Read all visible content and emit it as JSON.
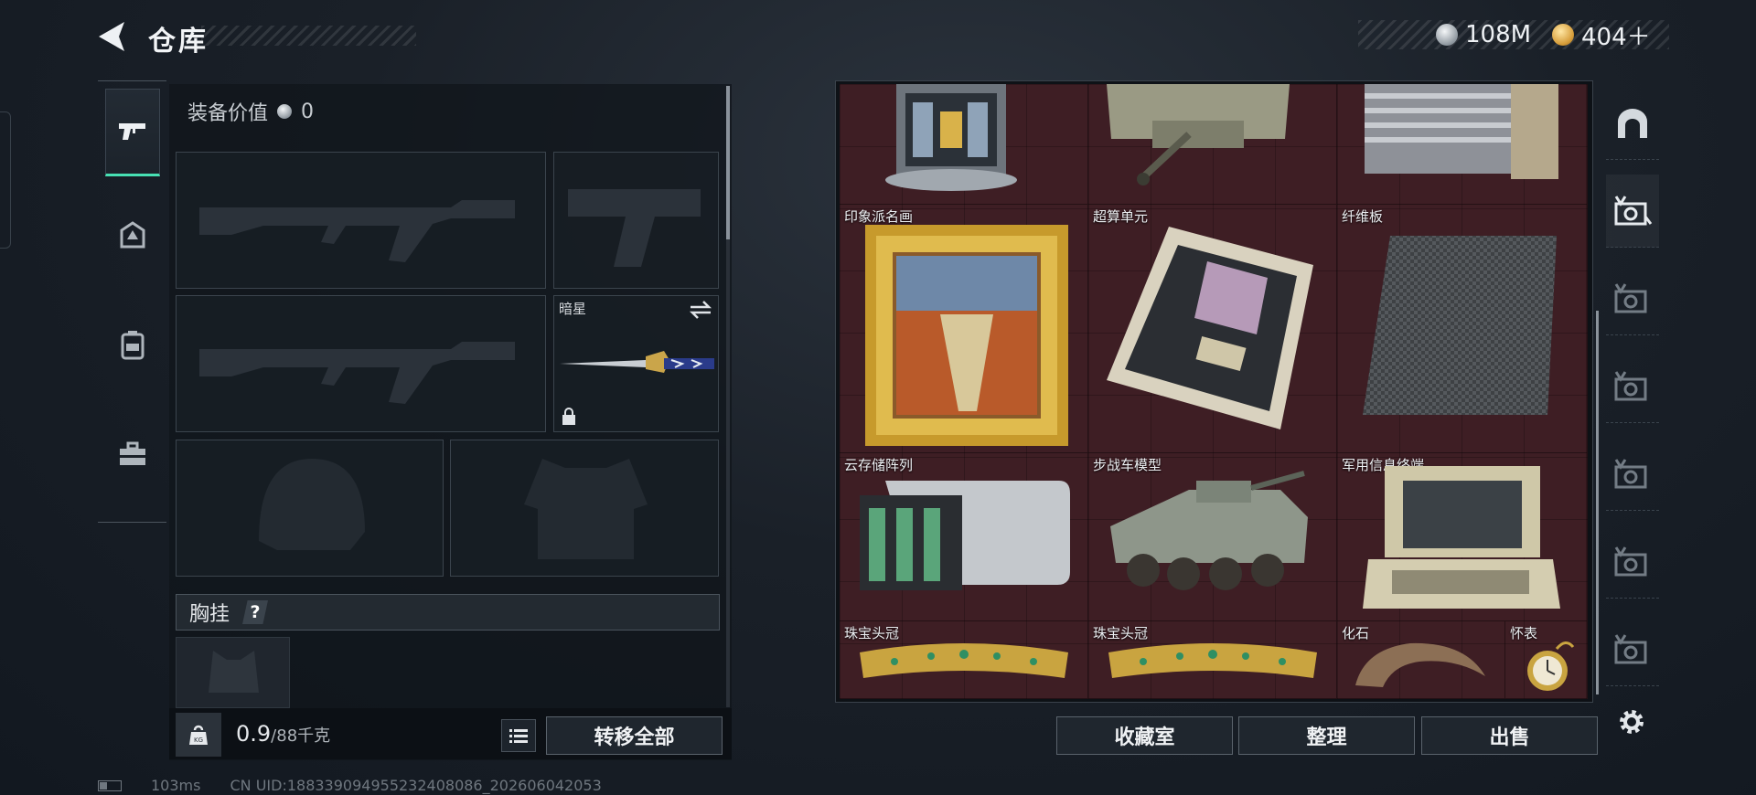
{
  "header": {
    "title": "仓库",
    "back_icon": "back-arrow-icon"
  },
  "currencies": [
    {
      "icon": "silver-coin-icon",
      "color": "#b9c0c7",
      "value": "108M"
    },
    {
      "icon": "gold-coin-icon",
      "color": "#d69d3a",
      "value": "404＋"
    }
  ],
  "left_tabs": [
    {
      "icon": "pistol-icon",
      "active": true
    },
    {
      "icon": "helmet-icon",
      "active": false
    },
    {
      "icon": "backpack-icon",
      "active": false
    },
    {
      "icon": "toolbox-icon",
      "active": false
    }
  ],
  "loadout": {
    "equip_value_label": "装备价值",
    "equip_value": "0",
    "melee_slot_name": "暗星",
    "chest_rig_label": "胸挂",
    "chest_rig_help": "?",
    "weight": "0.9",
    "weight_max": "/88千克",
    "transfer_all_label": "转移全部"
  },
  "warehouse": {
    "accent_color": "#3e1e24",
    "items": [
      {
        "name": "",
        "icon": "server-tower-icon"
      },
      {
        "name": "",
        "icon": "tank-model-icon"
      },
      {
        "name": "",
        "icon": "machine-rack-icon"
      },
      {
        "name": "印象派名画",
        "icon": "framed-painting-icon"
      },
      {
        "name": "超算单元",
        "icon": "supercomputer-board-icon"
      },
      {
        "name": "纤维板",
        "icon": "carbon-fiber-plate-icon"
      },
      {
        "name": "云存储阵列",
        "icon": "storage-array-icon"
      },
      {
        "name": "步战车模型",
        "icon": "ifv-model-icon"
      },
      {
        "name": "军用信息终端",
        "icon": "military-terminal-icon"
      },
      {
        "name": "珠宝头冠",
        "icon": "jeweled-tiara-icon"
      },
      {
        "name": "珠宝头冠",
        "icon": "jeweled-tiara-icon"
      },
      {
        "name": "化石",
        "icon": "fossil-claw-icon"
      },
      {
        "name": "怀表",
        "icon": "pocket-watch-icon"
      }
    ],
    "buttons": {
      "collection": "收藏室",
      "sort": "整理",
      "sell": "出售"
    }
  },
  "side_tabs": [
    {
      "icon": "arch-icon",
      "active": false
    },
    {
      "icon": "storage-v-icon-1",
      "active": true
    },
    {
      "icon": "storage-v-icon-2",
      "active": false
    },
    {
      "icon": "storage-v-icon-3",
      "active": false
    },
    {
      "icon": "storage-v-icon-4",
      "active": false
    },
    {
      "icon": "storage-v-icon-5",
      "active": false
    },
    {
      "icon": "storage-v-icon-6",
      "active": false
    },
    {
      "icon": "settings-gear-icon",
      "active": false
    }
  ],
  "status": {
    "ping": "103ms",
    "uid": "CN UID:188339094955232408086_202606042053"
  }
}
